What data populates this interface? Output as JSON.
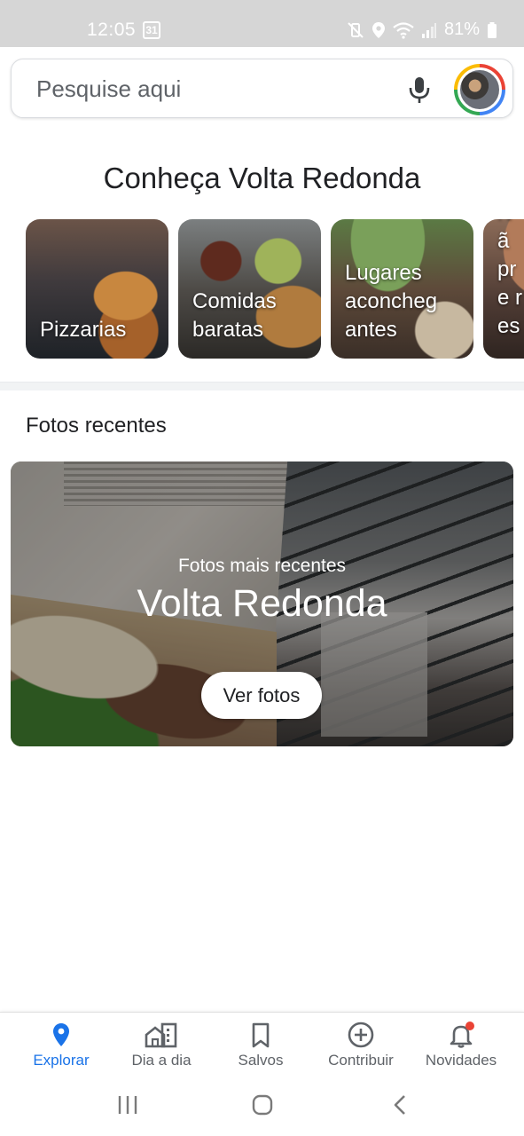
{
  "status_bar": {
    "time": "12:05",
    "calendar_badge": "31",
    "battery": "81%",
    "icons": [
      "mute-vibrate-icon",
      "location-icon",
      "wifi-icon",
      "signal-icon",
      "battery-icon"
    ]
  },
  "search": {
    "placeholder": "Pesquise aqui",
    "icons": [
      "mic-icon",
      "avatar"
    ]
  },
  "explore": {
    "title": "Conheça Volta Redonda",
    "categories": [
      {
        "label": "Pizzarias"
      },
      {
        "label": "Comidas baratas"
      },
      {
        "label": "Lugares aconcheg antes"
      },
      {
        "label": "Nã pre res"
      }
    ]
  },
  "photos": {
    "title": "Fotos recentes",
    "subtitle": "Fotos mais recentes",
    "place": "Volta Redonda",
    "button_label": "Ver fotos"
  },
  "bottom_nav": {
    "items": [
      {
        "label": "Explorar",
        "icon": "location-pin-icon",
        "active": true
      },
      {
        "label": "Dia a dia",
        "icon": "commute-icon",
        "active": false
      },
      {
        "label": "Salvos",
        "icon": "bookmark-icon",
        "active": false
      },
      {
        "label": "Contribuir",
        "icon": "add-circle-icon",
        "active": false
      },
      {
        "label": "Novidades",
        "icon": "bell-icon",
        "active": false,
        "badge": true
      }
    ]
  },
  "colors": {
    "accent": "#1a73e8",
    "status_bar_bg": "#d6d6d6",
    "text_primary": "#202124",
    "text_secondary": "#5f6368",
    "badge": "#ea4335"
  }
}
